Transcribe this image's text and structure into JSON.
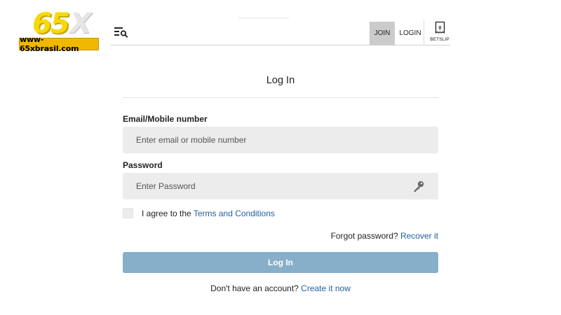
{
  "logo": {
    "mark_digits": "65",
    "mark_letter": "X",
    "url_text": "www-65xbrasil.com"
  },
  "header": {
    "menu_icon": "menu-search-icon",
    "join_label": "JOIN",
    "login_label": "LOGIN",
    "betslip": {
      "icon": "betslip-icon",
      "count": "0",
      "label": "BETSLIP"
    }
  },
  "form": {
    "title": "Log In",
    "email": {
      "label": "Email/Mobile number",
      "placeholder": "Enter email or mobile number",
      "value": ""
    },
    "password": {
      "label": "Password",
      "placeholder": "Enter Password",
      "value": "",
      "toggle_icon": "key-icon"
    },
    "terms": {
      "checked": false,
      "prefix": "I agree to the",
      "link": "Terms and Conditions"
    },
    "forgot": {
      "prefix": "Forgot password?",
      "link": "Recover it"
    },
    "submit_label": "Log In",
    "signup": {
      "prefix": "Don't have an account?",
      "link": "Create it now"
    }
  },
  "colors": {
    "logo_yellow": "#f5d90a",
    "logo_banner": "#f0b800",
    "join_bg": "#cbcbcb",
    "input_bg": "#ececec",
    "link": "#1f5fa0",
    "button_bg": "#87afc9"
  }
}
